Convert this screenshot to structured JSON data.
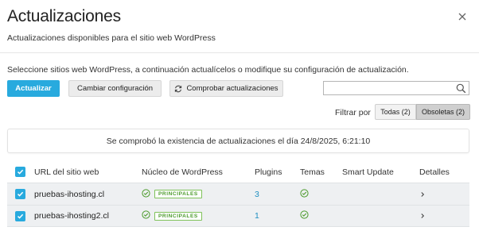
{
  "header": {
    "title": "Actualizaciones",
    "subtitle": "Actualizaciones disponibles para el sitio web WordPress"
  },
  "instructions": "Seleccione sitios web WordPress, a continuación actualícelos o modifique su configuración de actualización.",
  "toolbar": {
    "update_label": "Actualizar",
    "config_label": "Cambiar configuración",
    "check_label": "Comprobar actualizaciones"
  },
  "search": {
    "value": "",
    "placeholder": ""
  },
  "filter": {
    "label": "Filtrar por",
    "all_label": "Todas (2)",
    "obsolete_label": "Obsoletas (2)",
    "selected": "Obsoletas (2)"
  },
  "status_message": "Se comprobó la existencia de actualizaciones el día 24/8/2025, 6:21:10",
  "table": {
    "columns": {
      "url": "URL del sitio web",
      "core": "Núcleo de WordPress",
      "plugins": "Plugins",
      "themes": "Temas",
      "smart_update": "Smart Update",
      "details": "Detalles"
    },
    "rows": [
      {
        "checked": true,
        "url": "pruebas-ihosting.cl",
        "core_badge": "PRINCIPALES",
        "plugins": "3",
        "themes_icon": "check-circle-icon",
        "smart_update": ""
      },
      {
        "checked": true,
        "url": "pruebas-ihosting2.cl",
        "core_badge": "PRINCIPALES",
        "plugins": "1",
        "themes_icon": "check-circle-icon",
        "smart_update": ""
      }
    ]
  },
  "colors": {
    "accent": "#28aade",
    "success": "#4a9a2a",
    "link": "#1f8fc0"
  }
}
